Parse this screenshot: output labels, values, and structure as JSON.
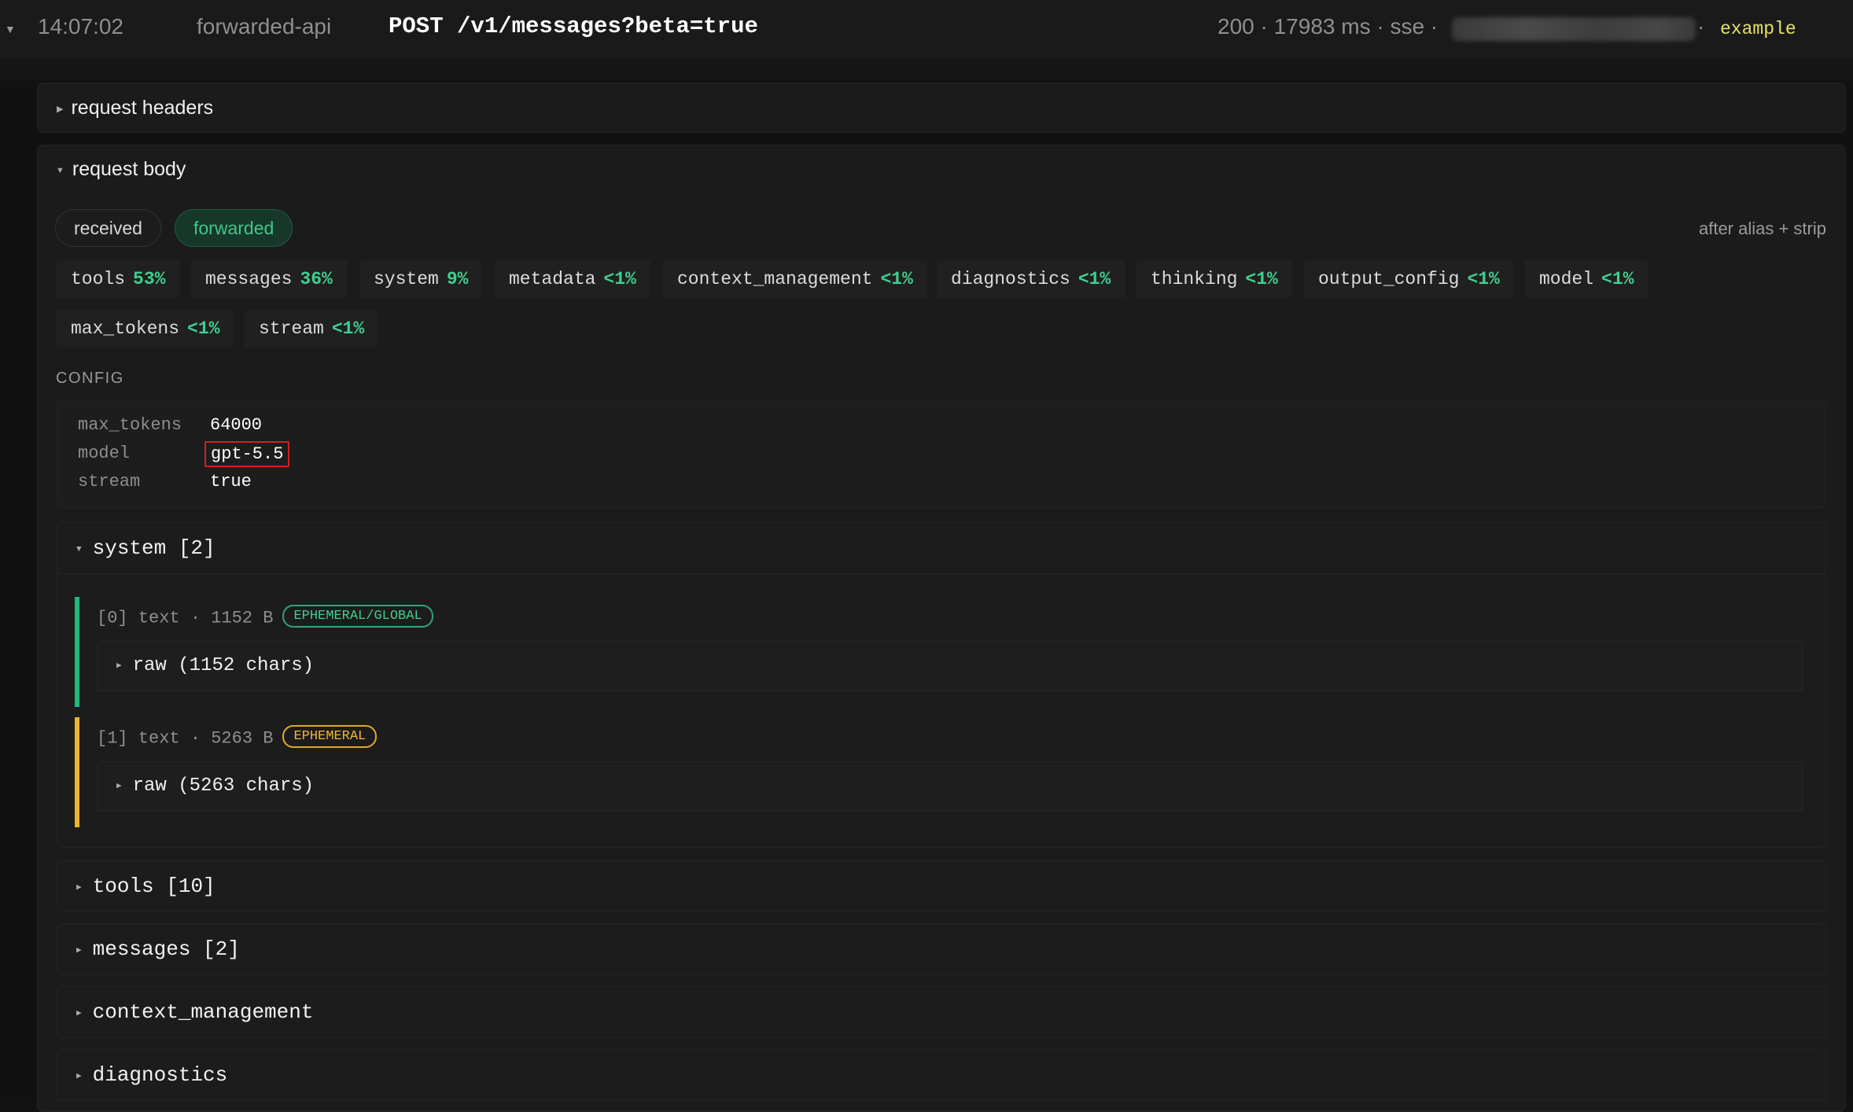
{
  "header": {
    "time": "14:07:02",
    "source": "forwarded-api",
    "route": "POST /v1/messages?beta=true",
    "meta": "200 · 17983 ms · sse ·",
    "separator": "·",
    "env": "example"
  },
  "request_headers": {
    "title": "request headers"
  },
  "request_body": {
    "title": "request body",
    "toggle": {
      "received": "received",
      "forwarded": "forwarded",
      "selected": "forwarded"
    },
    "note": "after alias + strip",
    "fields": [
      {
        "name": "tools",
        "pct": "53%"
      },
      {
        "name": "messages",
        "pct": "36%"
      },
      {
        "name": "system",
        "pct": "9%"
      },
      {
        "name": "metadata",
        "pct": "<1%"
      },
      {
        "name": "context_management",
        "pct": "<1%"
      },
      {
        "name": "diagnostics",
        "pct": "<1%"
      },
      {
        "name": "thinking",
        "pct": "<1%"
      },
      {
        "name": "output_config",
        "pct": "<1%"
      },
      {
        "name": "model",
        "pct": "<1%"
      },
      {
        "name": "max_tokens",
        "pct": "<1%"
      },
      {
        "name": "stream",
        "pct": "<1%"
      }
    ],
    "config_label": "CONFIG",
    "config": [
      {
        "key": "max_tokens",
        "value": "64000"
      },
      {
        "key": "model",
        "value": "gpt-5.5"
      },
      {
        "key": "stream",
        "value": "true"
      }
    ],
    "system": {
      "title": "system [2]",
      "items": [
        {
          "header": "[0] text · 1152 B",
          "badge": "EPHEMERAL/GLOBAL",
          "raw": "raw (1152 chars)",
          "color": "#1db97a"
        },
        {
          "header": "[1] text · 5263 B",
          "badge": "EPHEMERAL",
          "raw": "raw (5263 chars)",
          "color": "#e9b430"
        }
      ]
    },
    "sections": [
      {
        "title": "tools [10]"
      },
      {
        "title": "messages [2]"
      },
      {
        "title": "context_management"
      },
      {
        "title": "diagnostics"
      }
    ]
  }
}
